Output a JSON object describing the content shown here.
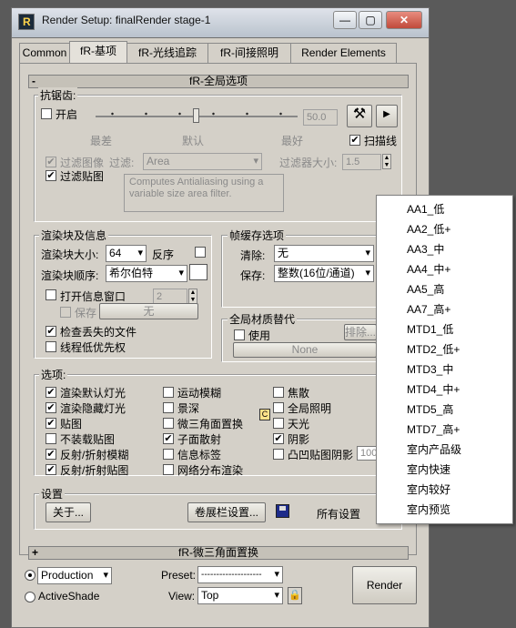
{
  "window": {
    "title": "Render Setup: finalRender stage-1",
    "minimize": "—",
    "maximize": "▢",
    "close": "✕"
  },
  "tabs": [
    "Common",
    "fR-基项",
    "fR-光线追踪",
    "fR-间接照明",
    "Render Elements"
  ],
  "global_rollout": {
    "sign": "-",
    "title": "fR-全局选项",
    "antialias": {
      "group_label": "抗锯齿:",
      "enable_label": "开启",
      "slider_value": "50.0",
      "quality_labels": [
        "最差",
        "默认",
        "最好"
      ],
      "scanline_label": "扫描线",
      "scanline_checked": true,
      "filter_image_label": "过滤图像",
      "filter_label": "过滤:",
      "filter_value": "Area",
      "filter_size_label": "过滤器大小:",
      "filter_size_value": "1.5",
      "filter_maps_label": "过滤贴图",
      "filter_maps_checked": true,
      "filter_desc": "Computes Antialiasing using a variable size area filter."
    },
    "render_block": {
      "group_label": "渲染块及信息",
      "block_size_label": "渲染块大小:",
      "block_size_value": "64",
      "reverse_label": "反序",
      "block_order_label": "渲染块顺序:",
      "block_order_value": "希尔伯特",
      "info_window_label": "打开信息窗口",
      "info_value": "2",
      "save_label": "保存",
      "none_label": "无",
      "check_missing_label": "检查丢失的文件",
      "check_missing_checked": true,
      "low_priority_label": "线程低优先权"
    },
    "frame_buffer": {
      "group_label": "帧缓存选项",
      "clear_label": "清除:",
      "clear_value": "无",
      "save_label": "保存:",
      "save_value": "整数(16位/通道)"
    },
    "material_override": {
      "group_label": "全局材质替代",
      "use_label": "使用",
      "exclude_label": "排除...",
      "none_label": "None"
    },
    "options": {
      "group_label": "选项:",
      "col1": [
        {
          "label": "渲染默认灯光",
          "checked": true
        },
        {
          "label": "渲染隐藏灯光",
          "checked": true
        },
        {
          "label": "贴图",
          "checked": true
        },
        {
          "label": "不装载贴图",
          "checked": false
        },
        {
          "label": "反射/折射模糊",
          "checked": true
        },
        {
          "label": "反射/折射贴图",
          "checked": true
        }
      ],
      "col2": [
        {
          "label": "运动模糊",
          "checked": false
        },
        {
          "label": "景深",
          "checked": false
        },
        {
          "label": "微三角面置换",
          "checked": false
        },
        {
          "label": "子面散射",
          "checked": true
        },
        {
          "label": "信息标签",
          "checked": false
        },
        {
          "label": "网络分布渲染",
          "checked": false
        }
      ],
      "col3": [
        {
          "label": "焦散",
          "checked": false
        },
        {
          "label": "全局照明",
          "checked": false
        },
        {
          "label": "天光",
          "checked": false
        },
        {
          "label": "阴影",
          "checked": true
        },
        {
          "label": "凸凹贴图阴影",
          "checked": false
        }
      ],
      "bump_value": "100"
    },
    "settings": {
      "group_label": "设置",
      "about_label": "关于...",
      "rollout_settings_label": "卷展栏设置...",
      "all_settings_label": "所有设置"
    }
  },
  "micro_rollout": {
    "sign": "+",
    "title": "fR-微三角面置换"
  },
  "bottom": {
    "production_label": "Production",
    "activeshade_label": "ActiveShade",
    "preset_label": "Preset:",
    "preset_value": "--------------------",
    "view_label": "View:",
    "view_value": "Top",
    "render_label": "Render"
  },
  "preset_menu": [
    "AA1_低",
    "AA2_低+",
    "AA3_中",
    "AA4_中+",
    "AA5_高",
    "AA7_高+",
    "MTD1_低",
    "MTD2_低+",
    "MTD3_中",
    "MTD4_中+",
    "MTD5_高",
    "MTD7_高+",
    "室内产品级",
    "室内快速",
    "室内较好",
    "室内预览"
  ]
}
